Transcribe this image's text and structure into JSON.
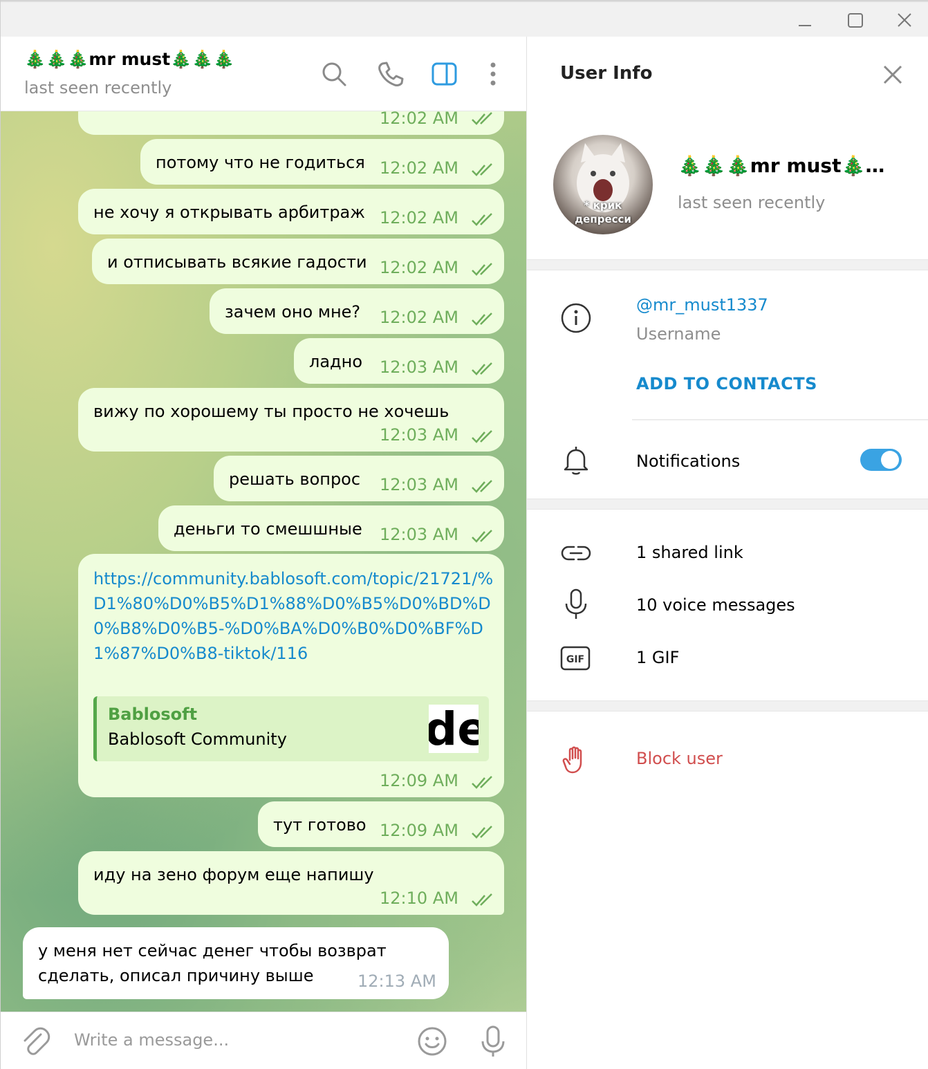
{
  "window": {
    "controls": {
      "minimize": "minimize",
      "maximize": "maximize",
      "close": "close"
    }
  },
  "header": {
    "peer_name": "🎄🎄🎄mr must🎄🎄🎄",
    "peer_status": "last seen recently",
    "icons": [
      "search-icon",
      "phone-icon",
      "sidebar-toggle-icon",
      "more-vertical-icon"
    ]
  },
  "messages": [
    {
      "text": "",
      "time": "12:02 AM",
      "outgoing": true,
      "read": true
    },
    {
      "text": "потому что не годиться",
      "time": "12:02 AM",
      "outgoing": true,
      "read": true
    },
    {
      "text": "не хочу я открывать арбитраж",
      "time": "12:02 AM",
      "outgoing": true,
      "read": true
    },
    {
      "text": "и отписывать всякие гадости",
      "time": "12:02 AM",
      "outgoing": true,
      "read": true
    },
    {
      "text": "зачем оно мне?",
      "time": "12:02 AM",
      "outgoing": true,
      "read": true
    },
    {
      "text": "ладно",
      "time": "12:03 AM",
      "outgoing": true,
      "read": true
    },
    {
      "text": "вижу по хорошему ты просто не хочешь",
      "time": "12:03 AM",
      "outgoing": true,
      "read": true
    },
    {
      "text": "решать вопрос",
      "time": "12:03 AM",
      "outgoing": true,
      "read": true
    },
    {
      "text": "деньги то смешшные",
      "time": "12:03 AM",
      "outgoing": true,
      "read": true
    },
    {
      "text": "https://community.bablosoft.com/topic/21721/%D1%80%D0%B5%D1%88%D0%B5%D0%BD%D0%B8%D0%B5-%D0%BA%D0%B0%D0%BF%D1%87%D0%B8-tiktok/116",
      "time": "12:09 AM",
      "outgoing": true,
      "read": true,
      "preview": {
        "site": "Bablosoft",
        "title": "Bablosoft Community",
        "thumb_text": "de"
      }
    },
    {
      "text": "тут готово",
      "time": "12:09 AM",
      "outgoing": true,
      "read": true
    },
    {
      "text": "иду на зено форум еще напишу",
      "time": "12:10 AM",
      "outgoing": true,
      "read": true
    },
    {
      "text_line1": "у меня нет сейчас денег чтобы возврат",
      "text_line2": "сделать, описал причину выше",
      "time": "12:13 AM",
      "outgoing": false
    }
  ],
  "composer": {
    "placeholder": "Write a message...",
    "icons": [
      "attach-icon",
      "emoji-icon",
      "microphone-icon"
    ]
  },
  "user_info": {
    "title": "User Info",
    "name": "🎄🎄🎄mr must🎄…",
    "status": "last seen recently",
    "avatar_caption_line1": "* крик",
    "avatar_caption_line2": "депресси",
    "username": "@mr_must1337",
    "username_label": "Username",
    "add_to_contacts": "ADD TO CONTACTS",
    "notifications_label": "Notifications",
    "notifications_on": true,
    "shared_links": "1 shared link",
    "voice_messages": "10 voice messages",
    "gifs": "1 GIF",
    "block_user": "Block user"
  },
  "colors": {
    "accent": "#168acd",
    "outgoing_bubble": "#effdde",
    "time_outgoing": "#6fae5c",
    "danger": "#d14e4e",
    "toggle_on": "#3aa3e3"
  }
}
